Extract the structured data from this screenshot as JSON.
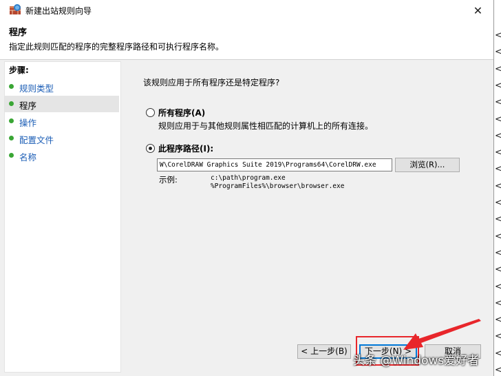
{
  "window": {
    "title": "新建出站规则向导",
    "close_glyph": "✕"
  },
  "header": {
    "title": "程序",
    "description": "指定此规则匹配的程序的完整程序路径和可执行程序名称。"
  },
  "sidebar": {
    "heading": "步骤:",
    "items": [
      {
        "label": "规则类型",
        "state": "link"
      },
      {
        "label": "程序",
        "state": "current"
      },
      {
        "label": "操作",
        "state": "link"
      },
      {
        "label": "配置文件",
        "state": "link"
      },
      {
        "label": "名称",
        "state": "link"
      }
    ]
  },
  "content": {
    "question": "该规则应用于所有程序还是特定程序?",
    "option_all": {
      "label": "所有程序(A)",
      "description": "规则应用于与其他规则属性相匹配的计算机上的所有连接。",
      "selected": false
    },
    "option_path": {
      "label": "此程序路径(I):",
      "selected": true,
      "value": "W\\CorelDRAW Graphics Suite 2019\\Programs64\\CorelDRW.exe",
      "browse_label": "浏览(R)..."
    },
    "example": {
      "label": "示例:",
      "lines": [
        "c:\\path\\program.exe",
        "%ProgramFiles%\\browser\\browser.exe"
      ]
    }
  },
  "buttons": {
    "back": "< 上一步(B)",
    "next": "下一步(N) >",
    "cancel": "取消"
  },
  "background_window": {
    "edge_chars": [
      "<",
      "<",
      "<",
      "<",
      "<",
      "<",
      "<",
      "<",
      "<",
      "<",
      "<",
      "<",
      "<",
      "<",
      "<",
      "<",
      "<",
      "<",
      "<",
      "<",
      "<"
    ]
  },
  "overlay": {
    "watermark": "头条 @Windows爱好者",
    "highlight_color": "#e8262b"
  }
}
